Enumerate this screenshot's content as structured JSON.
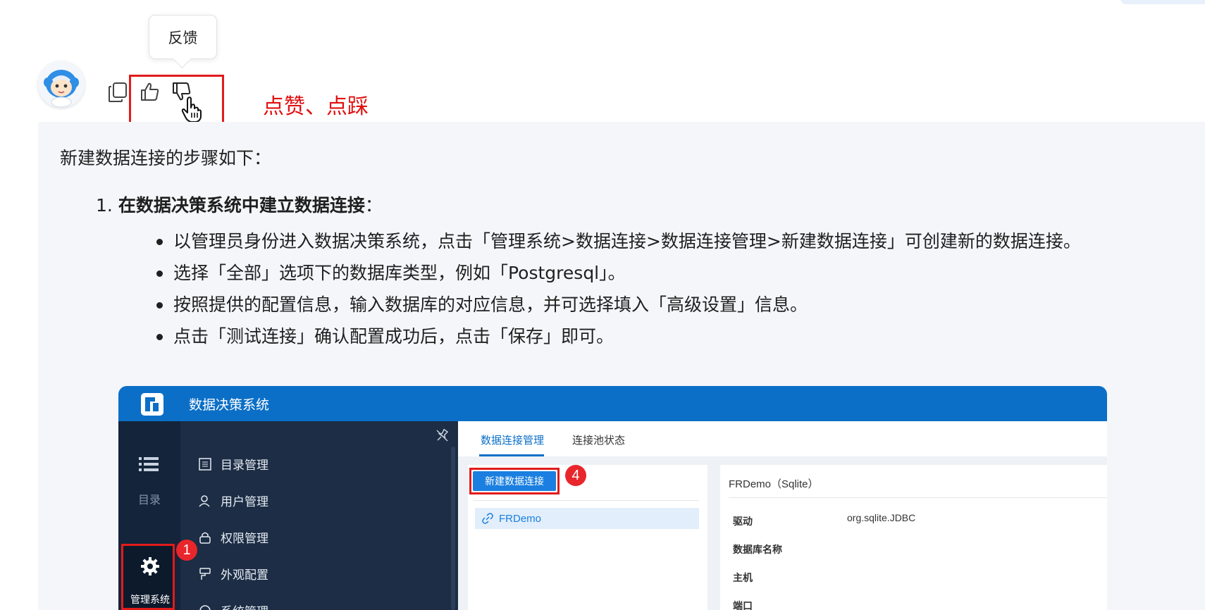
{
  "tooltip": {
    "text": "反馈"
  },
  "actions": {
    "copy_icon": "copy-icon",
    "like_icon": "thumbs-up-icon",
    "dislike_icon": "thumbs-down-icon"
  },
  "annotation": {
    "text": "点赞、点踩",
    "color": "#e01010"
  },
  "answer": {
    "intro": "新建数据连接的步骤如下：",
    "step": {
      "number": "1.",
      "title": "在数据决策系统中建立数据连接",
      "suffix": "："
    },
    "bullets": [
      "以管理员身份进入数据决策系统，点击「管理系统>数据连接>数据连接管理>新建数据连接」可创建新的数据连接。",
      "选择「全部」选项下的数据库类型，例如「Postgresql」。",
      "按照提供的配置信息，输入数据库的对应信息，并可选择填入「高级设置」信息。",
      "点击「测试连接」确认配置成功后，点击「保存」即可。"
    ]
  },
  "screenshot": {
    "app_title": "数据决策系统",
    "nav": {
      "directory_label": "目录",
      "admin_label": "管理系统"
    },
    "badges": {
      "admin": "1",
      "new_connection": "4"
    },
    "menu": [
      {
        "label": "目录管理",
        "icon": "list-icon"
      },
      {
        "label": "用户管理",
        "icon": "user-icon"
      },
      {
        "label": "权限管理",
        "icon": "lock-icon"
      },
      {
        "label": "外观配置",
        "icon": "brush-icon"
      },
      {
        "label": "系统管理",
        "icon": "system-icon"
      }
    ],
    "tabs": [
      "数据连接管理",
      "连接池状态"
    ],
    "new_connection_button": "新建数据连接",
    "connections": [
      "FRDemo"
    ],
    "detail": {
      "title": "FRDemo（Sqlite）",
      "fields": [
        {
          "label": "驱动",
          "value": "org.sqlite.JDBC"
        },
        {
          "label": "数据库名称",
          "value": ""
        },
        {
          "label": "主机",
          "value": ""
        },
        {
          "label": "端口",
          "value": ""
        }
      ]
    },
    "colors": {
      "header": "#0b6fc7",
      "nav": "#14243a",
      "highlight": "#e21b1b"
    }
  }
}
